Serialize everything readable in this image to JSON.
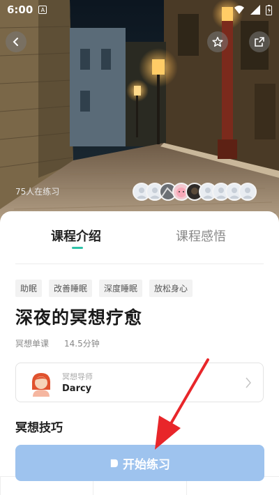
{
  "status_bar": {
    "time": "6:00",
    "app_badge": "A"
  },
  "hero": {
    "practicing_text": "75人在练习",
    "avatar_count": 9
  },
  "tabs": [
    {
      "label": "课程介绍",
      "active": true
    },
    {
      "label": "课程感悟",
      "active": false
    }
  ],
  "tags": [
    "助眠",
    "改善睡眠",
    "深度睡眠",
    "放松身心"
  ],
  "course": {
    "title": "深夜的冥想疗愈",
    "type": "冥想单课",
    "duration": "14.5分钟"
  },
  "mentor": {
    "label": "冥想导师",
    "name": "Darcy"
  },
  "section": {
    "title": "冥想技巧"
  },
  "start_button": {
    "label": "开始练习"
  },
  "colors": {
    "accent": "#2ec3a8",
    "button": "#9ec3ee",
    "annotation_arrow": "#e8262a"
  }
}
